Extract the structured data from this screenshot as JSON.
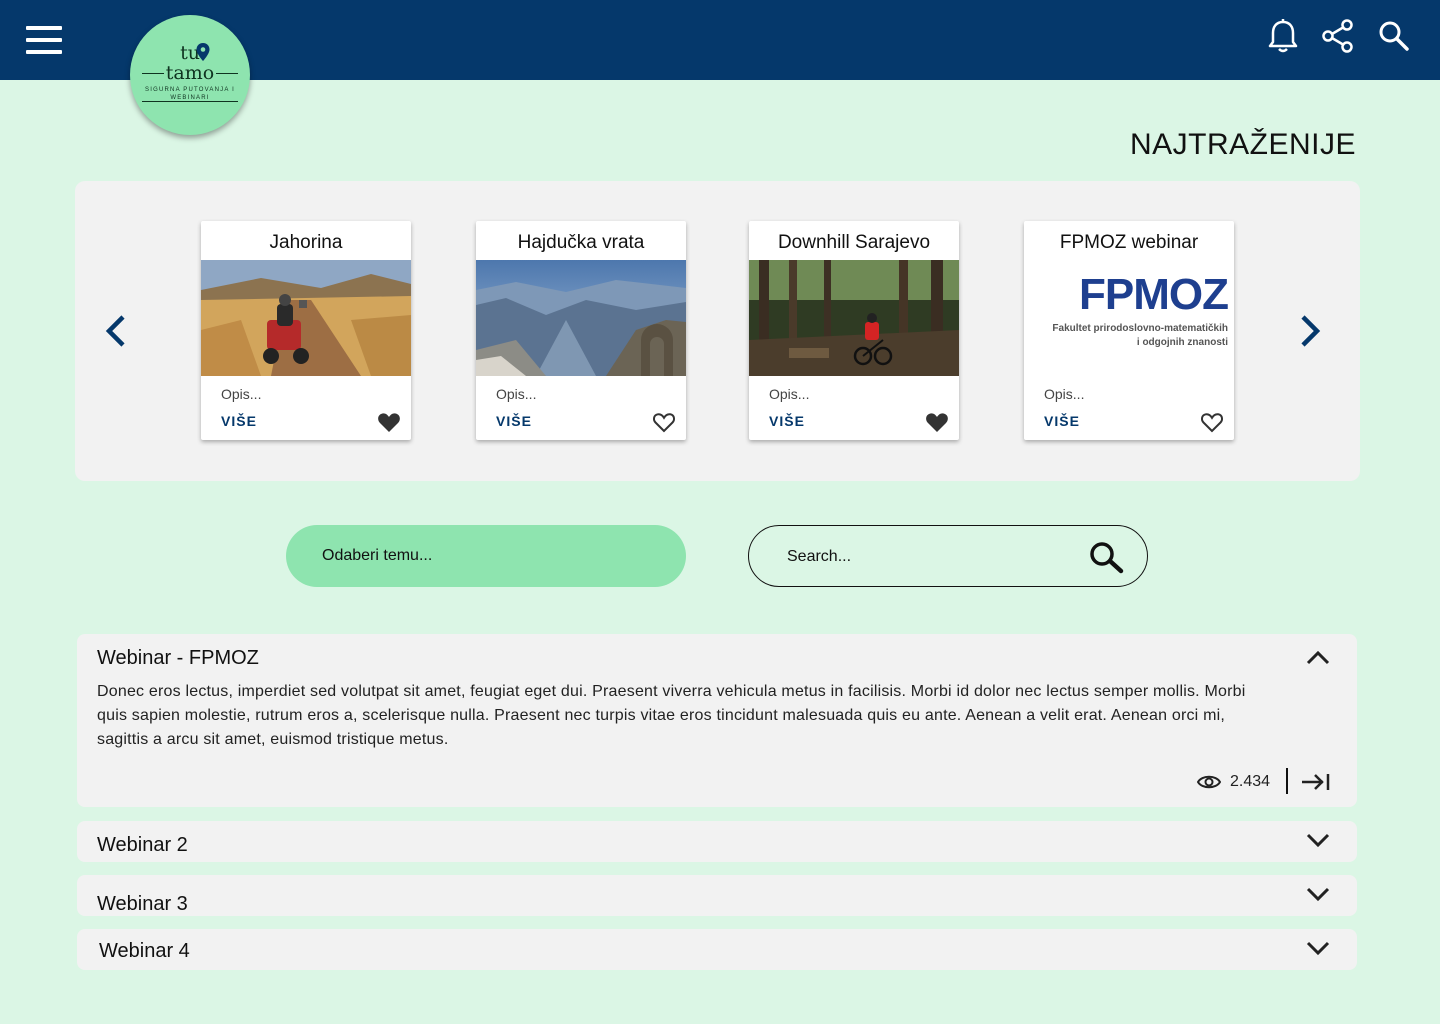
{
  "header": {
    "menu_icon": "hamburger-menu-icon",
    "icons": [
      "bell-icon",
      "share-icon",
      "search-icon"
    ],
    "background": "#05386b"
  },
  "logo": {
    "line1": "tu",
    "line2": "tamo",
    "tagline": "SIGURNA PUTOVANJA I WEBINARI",
    "background": "#8ee4af"
  },
  "section_title": "NAJTRAŽENIJE",
  "carousel": {
    "prev_icon": "chevron-left-icon",
    "next_icon": "chevron-right-icon",
    "cards": [
      {
        "title": "Jahorina",
        "description": "Opis...",
        "more_label": "VIŠE",
        "favorited": true,
        "image": "quad-bike-field-photo"
      },
      {
        "title": "Hajdučka vrata",
        "description": "Opis...",
        "more_label": "VIŠE",
        "favorited": false,
        "image": "mountain-arch-photo"
      },
      {
        "title": "Downhill Sarajevo",
        "description": "Opis...",
        "more_label": "VIŠE",
        "favorited": true,
        "image": "forest-mountain-bike-photo"
      },
      {
        "title": "FPMOZ webinar",
        "description": "Opis...",
        "more_label": "VIŠE",
        "favorited": false,
        "image": "fpmoz-logo",
        "logo_text": "FPMOZ",
        "logo_caption_1": "Fakultet prirodoslovno-matematičkih",
        "logo_caption_2": "i odgojnih znanosti"
      }
    ]
  },
  "filters": {
    "topic_select": "Odaberi temu...",
    "search_placeholder": "Search..."
  },
  "webinars": [
    {
      "title": "Webinar - FPMOZ",
      "expanded": true,
      "body": "Donec eros lectus, imperdiet sed volutpat sit amet, feugiat eget dui. Praesent viverra vehicula metus in facilisis. Morbi id dolor nec lectus semper mollis. Morbi quis sapien molestie, rutrum eros a, scelerisque nulla. Praesent nec turpis vitae eros tincidunt malesuada quis eu ante. Aenean a velit erat. Aenean orci mi, sagittis a arcu sit amet, euismod tristique metus.",
      "views": "2.434"
    },
    {
      "title": "Webinar 2",
      "expanded": false
    },
    {
      "title": "Webinar 3",
      "expanded": false
    },
    {
      "title": "Webinar 4",
      "expanded": false
    }
  ],
  "colors": {
    "page_background": "#dbf6e5",
    "accent_green": "#8ee4af",
    "navy": "#05386b",
    "panel": "#f2f2f2"
  }
}
